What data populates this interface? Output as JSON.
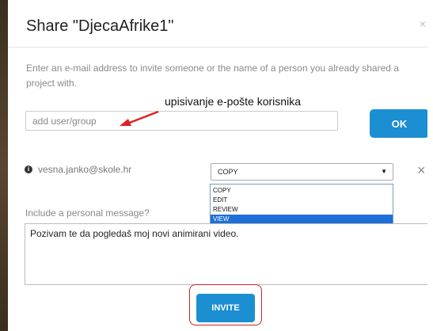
{
  "dialog": {
    "title": "Share \"DjecaAfrike1\"",
    "close_symbol": "×",
    "intro": "Enter an e-mail address to invite someone or the name of a person you already shared a project with."
  },
  "annotation": {
    "text": "upisivanje e-pošte korisnika",
    "arrow_color": "#e02020"
  },
  "add_user": {
    "placeholder": "add user/group",
    "ok_label": "OK"
  },
  "share_entry": {
    "info_symbol": "i",
    "email": "vesna.janko@skole.hr",
    "permission_selected": "COPY",
    "caret_symbol": "▼",
    "remove_symbol": "×",
    "options": [
      "COPY",
      "EDIT",
      "REVIEW",
      "VIEW"
    ],
    "highlighted_option": "VIEW"
  },
  "message": {
    "label": "Include a personal message?",
    "value": "Pozivam te da pogledaš moj novi animirani video."
  },
  "invite": {
    "label": "INVITE",
    "highlight_color": "#cc2222"
  },
  "colors": {
    "primary_button": "#1c8ed2",
    "dropdown_highlight": "#1e6fd8"
  }
}
